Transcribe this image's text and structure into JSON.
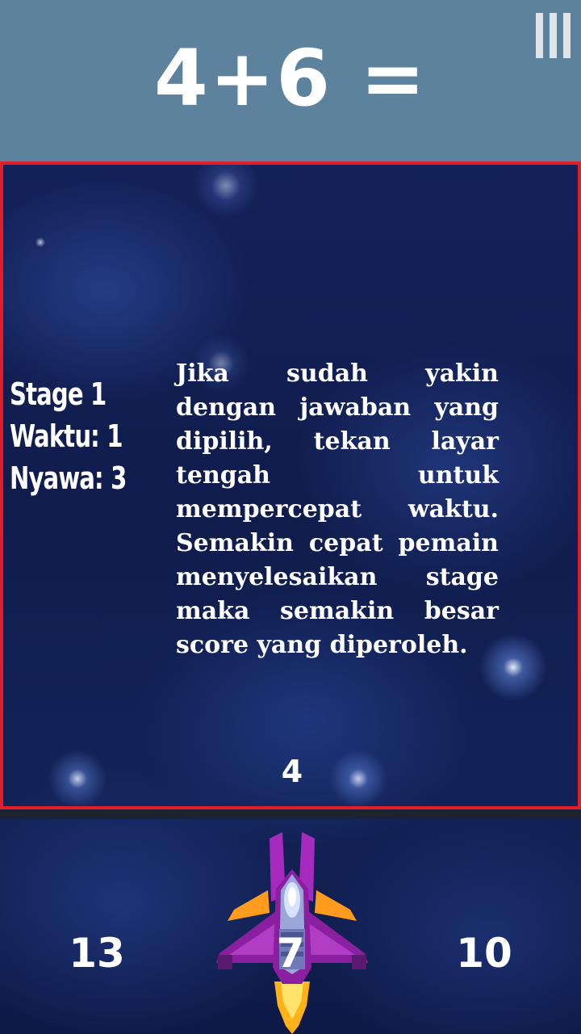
{
  "header": {
    "equation": "4+6 ="
  },
  "stats": {
    "stage": "Stage 1",
    "time": "Waktu: 1",
    "lives": "Nyawa: 3"
  },
  "instruction": "Jika sudah yakin dengan jawaban yang dipilih, tekan layar tengah untuk mempercepat waktu. Semakin cepat pemain menyelesaikan stage maka semakin besar score yang diperoleh.",
  "countdown": "4",
  "answers": [
    "13",
    "7",
    "10"
  ],
  "icons": {
    "menu": "menu-bars-icon",
    "player": "spaceship-icon"
  },
  "colors": {
    "header_bg": "#5d829e",
    "frame_border": "#e21c28",
    "ship_body": "#8a1fa0"
  }
}
